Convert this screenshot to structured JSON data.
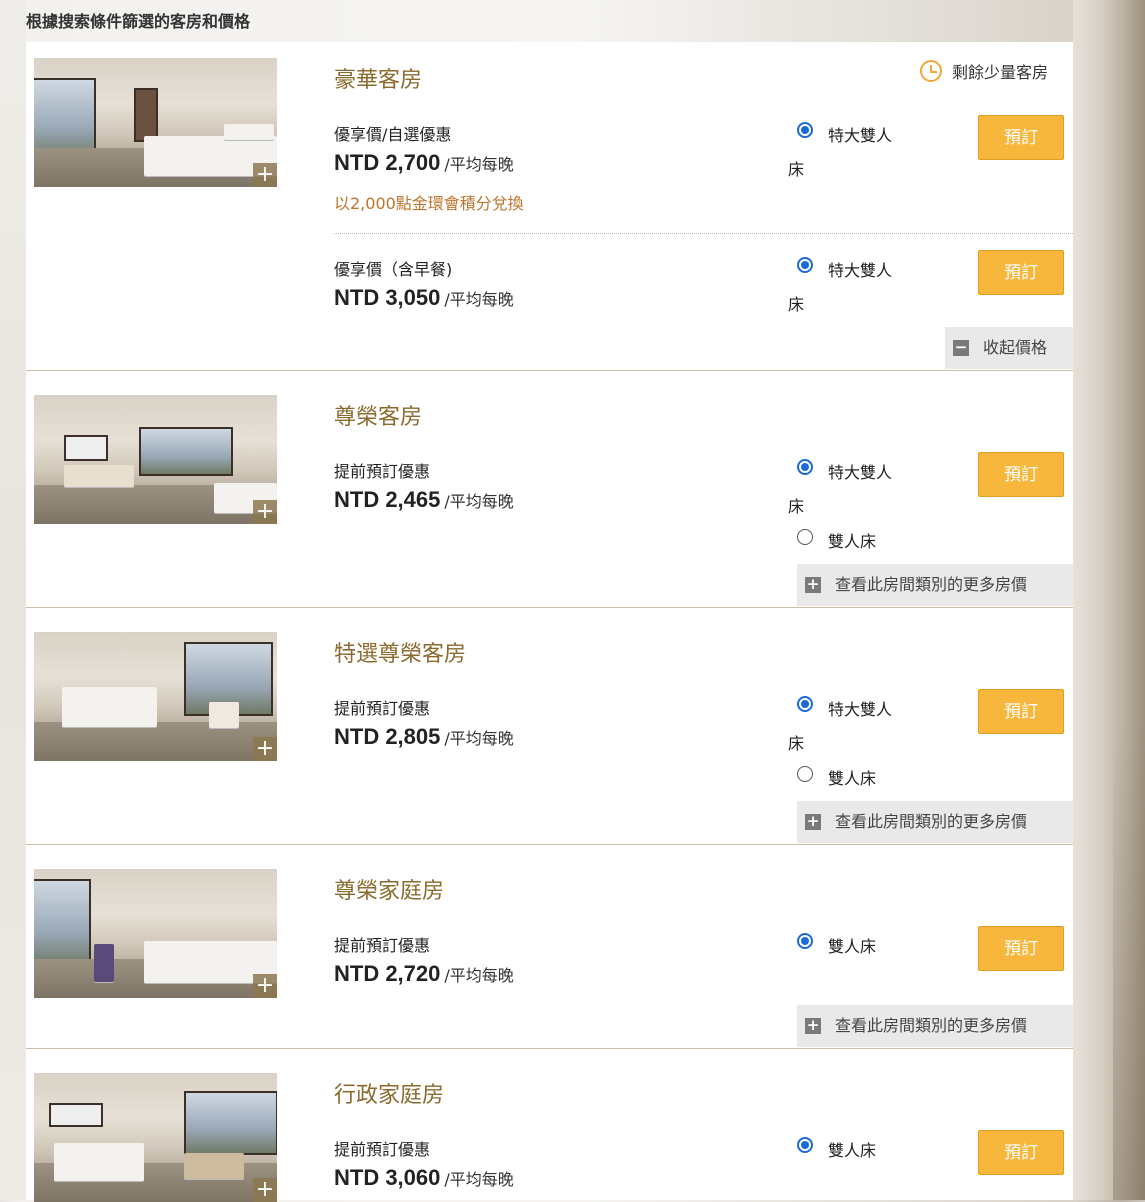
{
  "heading": "根據搜索條件篩選的客房和價格",
  "book_label": "預訂",
  "rooms": [
    {
      "name": "豪華客房",
      "availability": "剩餘少量客房",
      "rates": [
        {
          "name": "優享價/自選優惠",
          "price": "NTD 2,700",
          "unit": "/平均每晚",
          "points": "以2,000點金環會積分兌換",
          "beds": [
            {
              "label": "特大雙人",
              "wrap": "床",
              "selected": true
            }
          ]
        },
        {
          "name": "優享價（含早餐)",
          "price": "NTD 3,050",
          "unit": "/平均每晚",
          "beds": [
            {
              "label": "特大雙人",
              "wrap": "床",
              "selected": true
            }
          ]
        }
      ],
      "toggle": {
        "label": "收起價格",
        "icon": "minus-icon"
      }
    },
    {
      "name": "尊榮客房",
      "rates": [
        {
          "name": "提前預訂優惠",
          "price": "NTD 2,465",
          "unit": "/平均每晚",
          "beds": [
            {
              "label": "特大雙人",
              "wrap": "床",
              "selected": true
            },
            {
              "label": "雙人床",
              "selected": false
            }
          ]
        }
      ],
      "toggle": {
        "label": "查看此房間類別的更多房價",
        "icon": "plus-icon"
      }
    },
    {
      "name": "特選尊榮客房",
      "rates": [
        {
          "name": "提前預訂優惠",
          "price": "NTD 2,805",
          "unit": "/平均每晚",
          "beds": [
            {
              "label": "特大雙人",
              "wrap": "床",
              "selected": true
            },
            {
              "label": "雙人床",
              "selected": false
            }
          ]
        }
      ],
      "toggle": {
        "label": "查看此房間類別的更多房價",
        "icon": "plus-icon"
      }
    },
    {
      "name": "尊榮家庭房",
      "rates": [
        {
          "name": "提前預訂優惠",
          "price": "NTD 2,720",
          "unit": "/平均每晚",
          "beds": [
            {
              "label": "雙人床",
              "selected": true
            }
          ]
        }
      ],
      "toggle": {
        "label": "查看此房間類別的更多房價",
        "icon": "plus-icon"
      }
    },
    {
      "name": "行政家庭房",
      "rates": [
        {
          "name": "提前預訂優惠",
          "price": "NTD 3,060",
          "unit": "/平均每晚",
          "beds": [
            {
              "label": "雙人床",
              "selected": true
            }
          ]
        }
      ]
    }
  ]
}
